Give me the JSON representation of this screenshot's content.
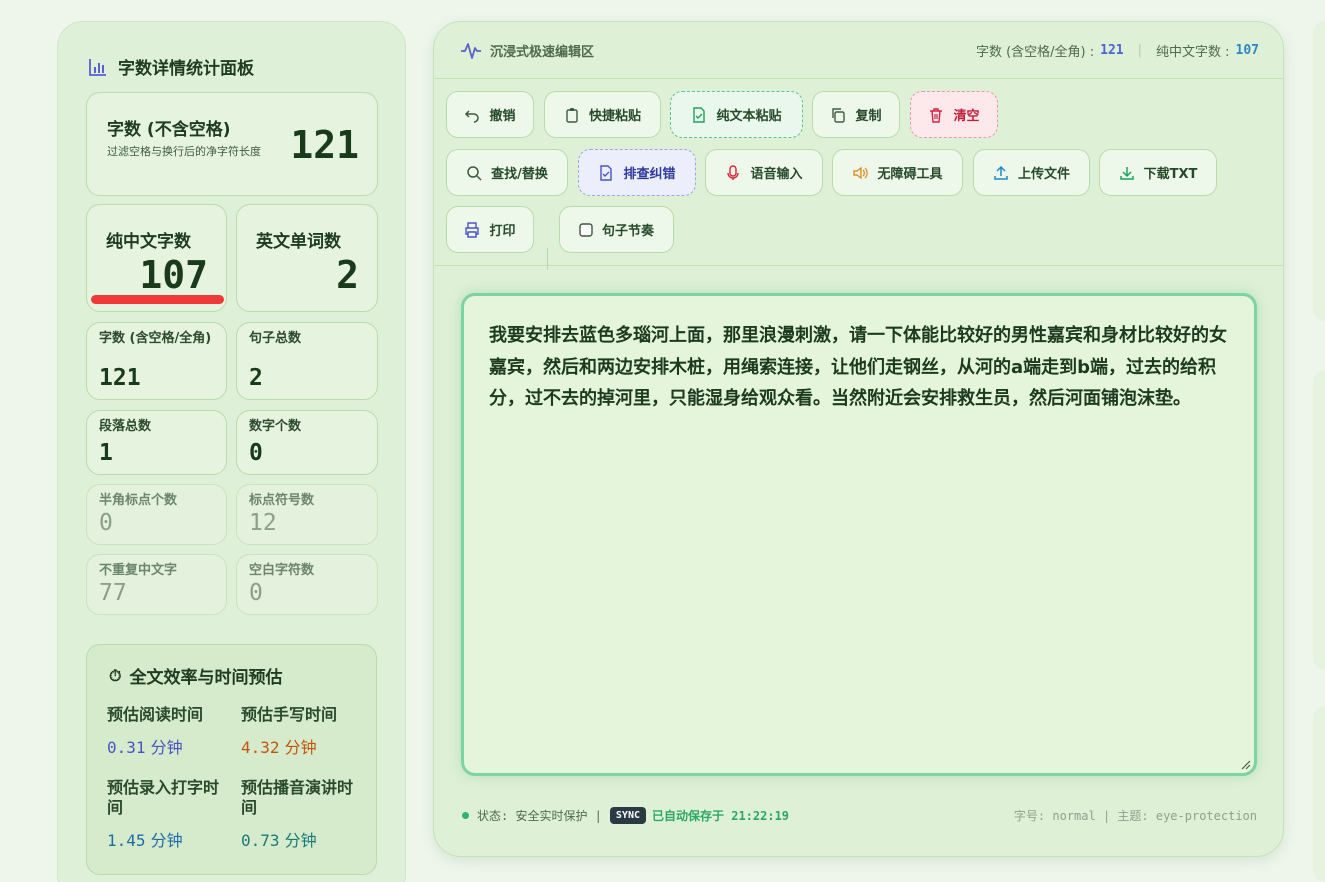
{
  "sidebar": {
    "title": "字数详情统计面板",
    "main_card": {
      "label": "字数 (不含空格)",
      "desc": "过滤空格与换行后的净字符长度",
      "value": "121"
    },
    "chinese_card": {
      "label": "纯中文字数",
      "value": "107"
    },
    "english_card": {
      "label": "英文单词数",
      "value": "2"
    },
    "stats": [
      {
        "label": "字数 (含空格/全角)",
        "value": "121"
      },
      {
        "label": "句子总数",
        "value": "2"
      },
      {
        "label": "段落总数",
        "value": "1"
      },
      {
        "label": "数字个数",
        "value": "0"
      },
      {
        "label": "半角标点个数",
        "value": "0"
      },
      {
        "label": "标点符号数",
        "value": "12"
      },
      {
        "label": "不重复中文字",
        "value": "77"
      },
      {
        "label": "空白字符数",
        "value": "0"
      }
    ],
    "time_box": {
      "title": "全文效率与时间预估",
      "read_label": "预估阅读时间",
      "read_value": "0.31",
      "read_unit": "分钟",
      "write_label": "预估手写时间",
      "write_value": "4.32",
      "write_unit": "分钟",
      "type_label": "预估录入打字时间",
      "type_value": "1.45",
      "type_unit": "分钟",
      "speak_label": "预估播音演讲时间",
      "speak_value": "0.73",
      "speak_unit": "分钟"
    }
  },
  "editor": {
    "title": "沉浸式极速编辑区",
    "count_label": "字数 (含空格/全角) :",
    "count_value": "121",
    "separator": "|",
    "chinese_label": "纯中文字数 :",
    "chinese_value": "107",
    "buttons": {
      "undo": "撤销",
      "quick_paste": "快捷粘贴",
      "plain_paste": "纯文本粘贴",
      "copy": "复制",
      "clear": "清空",
      "find_replace": "查找/替换",
      "proofread": "排查纠错",
      "voice": "语音输入",
      "accessibility": "无障碍工具",
      "upload": "上传文件",
      "download": "下载TXT",
      "print": "打印",
      "rhythm": "句子节奏"
    },
    "content": "我要安排去蓝色多瑙河上面，那里浪漫刺激，请一下体能比较好的男性嘉宾和身材比较好的女嘉宾，然后和两边安排木桩，用绳索连接，让他们走钢丝，从河的a端走到b端，过去的给积分，过不去的掉河里，只能湿身给观众看。当然附近会安排救生员，然后河面铺泡沫垫。",
    "status": {
      "state": "状态: 安全实时保护 |",
      "sync": "SYNC",
      "saved": "已自动保存于 21:22:19",
      "meta": "字号: normal | 主题: eye-protection"
    }
  },
  "colors": {
    "accent_blue": "#4b62d8",
    "accent_orange": "#c0560c",
    "accent_teal": "#1a7a7a",
    "accent_green": "#2ca864",
    "danger": "#c21f3a"
  }
}
